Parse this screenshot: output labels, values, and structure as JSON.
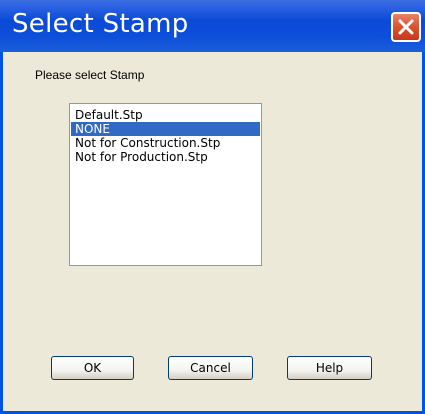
{
  "window": {
    "title": "Select Stamp"
  },
  "prompt": "Please select Stamp",
  "stamp_list": {
    "items": [
      {
        "label": "Default.Stp",
        "selected": false
      },
      {
        "label": "NONE",
        "selected": true
      },
      {
        "label": "Not for Construction.Stp",
        "selected": false
      },
      {
        "label": "Not for Production.Stp",
        "selected": false
      }
    ]
  },
  "buttons": {
    "ok_label": "OK",
    "cancel_label": "Cancel",
    "help_label": "Help"
  },
  "colors": {
    "titlebar": "#0a4ad6",
    "dialog_background": "#ece9d8",
    "selection": "#316ac5",
    "close_button": "#d9532f"
  },
  "icons": {
    "close": "close-icon"
  }
}
